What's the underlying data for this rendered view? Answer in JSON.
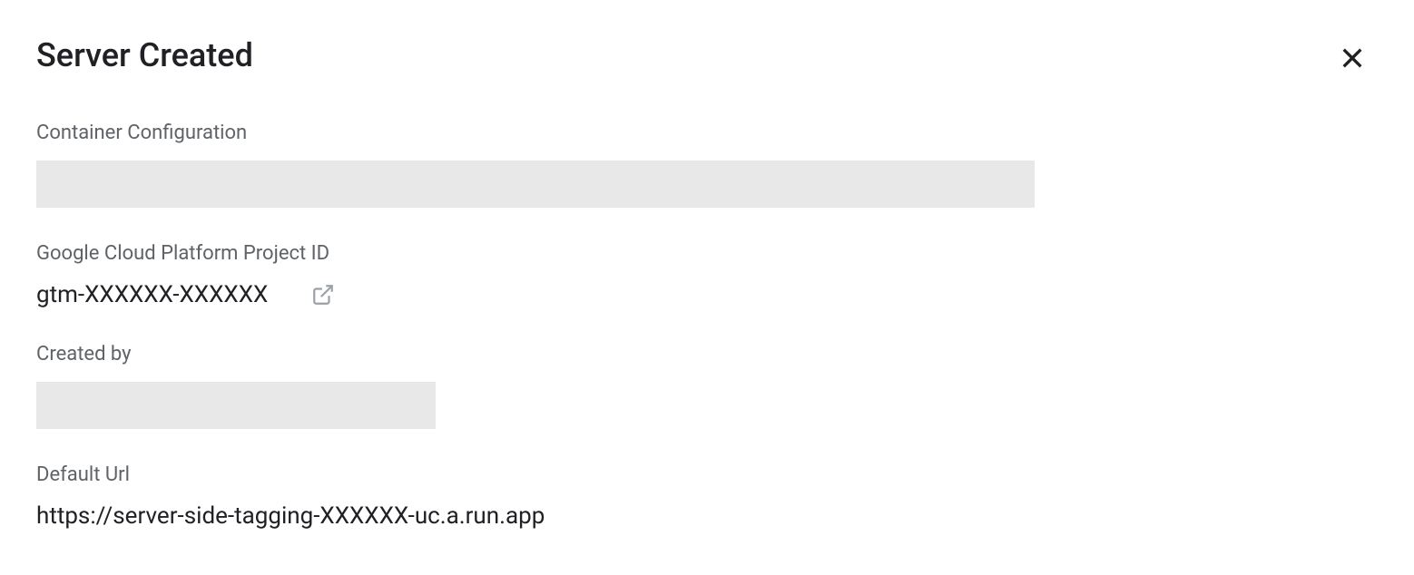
{
  "header": {
    "title": "Server Created"
  },
  "fields": {
    "container_config_label": "Container Configuration",
    "gcp_project_id_label": "Google Cloud Platform Project ID",
    "gcp_project_id_value": "gtm-XXXXXX-XXXXXX",
    "created_by_label": "Created by",
    "default_url_label": "Default Url",
    "default_url_value": "https://server-side-tagging-XXXXXX-uc.a.run.app"
  }
}
